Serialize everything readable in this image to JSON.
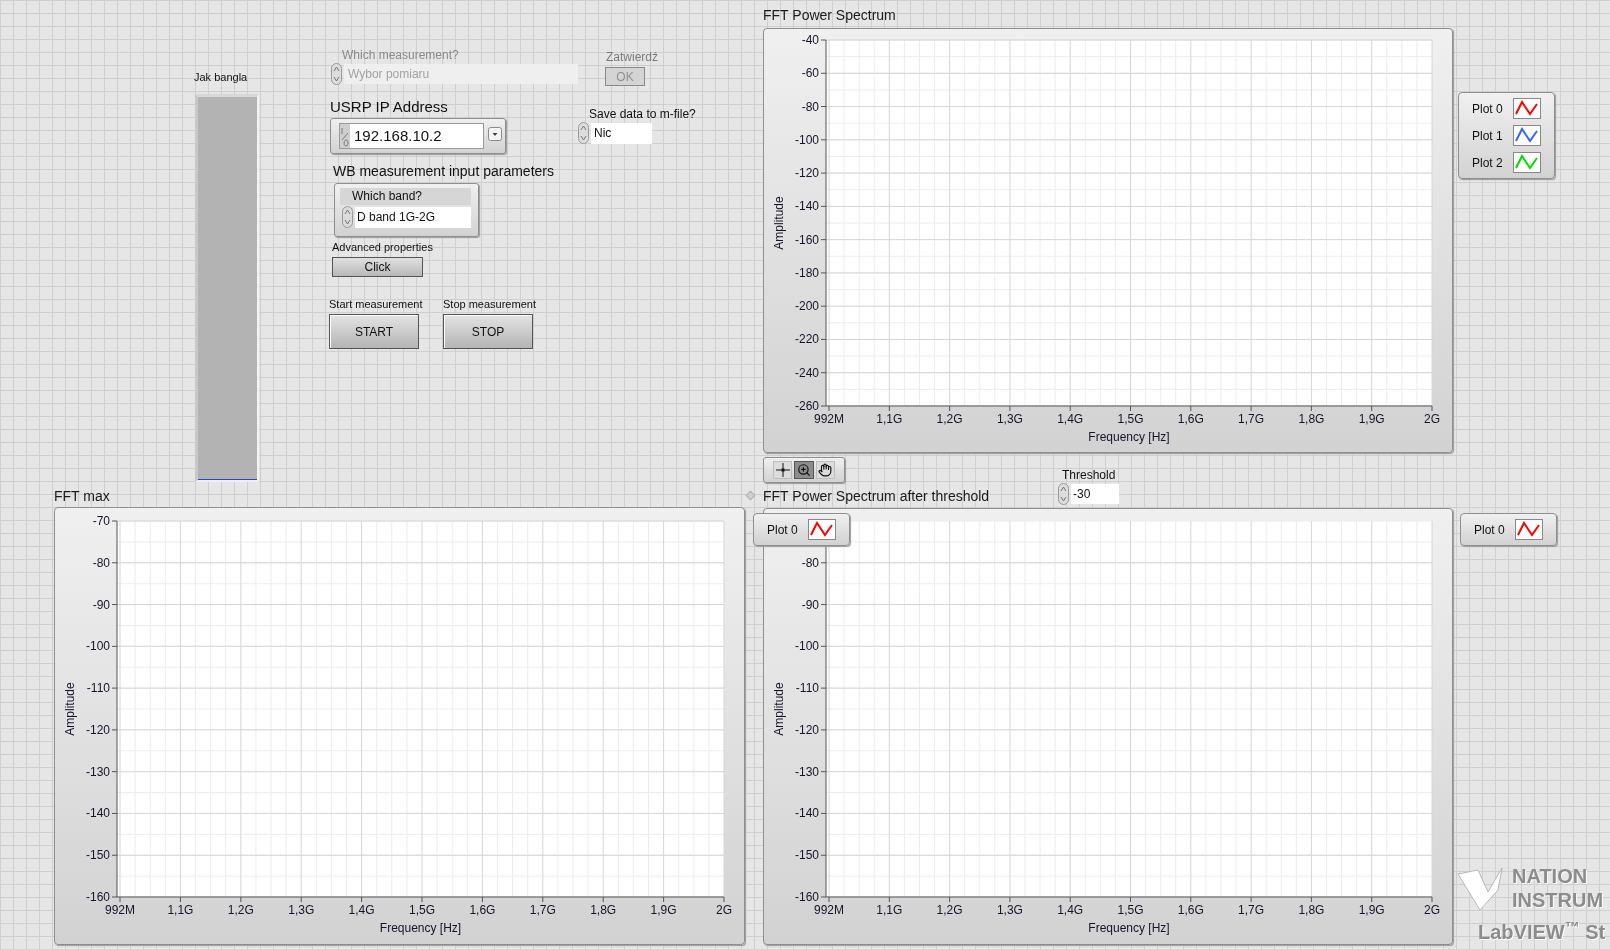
{
  "level_meter": {
    "label": "Jak bangla",
    "level": 0
  },
  "measurement_select": {
    "label": "Which measurement?",
    "value": "Wybor pomiaru",
    "disabled": true
  },
  "confirm": {
    "label": "Zatwierdź",
    "button": "OK",
    "disabled": true
  },
  "usrp_ip": {
    "label": "USRP IP Address",
    "value": "192.168.10.2"
  },
  "save_data": {
    "label": "Save data to m-file?",
    "value": "Nic"
  },
  "wb_params": {
    "title": "WB measurement input parameters",
    "band_label": "Which band?",
    "band_value": "D band 1G-2G"
  },
  "advanced": {
    "label": "Advanced properties",
    "button": "Click"
  },
  "start": {
    "label": "Start measurement",
    "button": "START"
  },
  "stop": {
    "label": "Stop measurement",
    "button": "STOP"
  },
  "graphs": [
    {
      "title": "FFT Power Spectrum",
      "legend": [
        {
          "name": "Plot 0",
          "color": "#ff0000"
        },
        {
          "name": "Plot 1",
          "color": "#3366ff"
        },
        {
          "name": "Plot 2",
          "color": "#00dd00"
        }
      ],
      "chart_data": {
        "type": "line",
        "grid": true,
        "xlabel": "Frequency [Hz]",
        "ylabel": "Amplitude",
        "ylim": [
          -260,
          -40
        ],
        "categories": [
          "992M",
          "1,1G",
          "1,2G",
          "1,3G",
          "1,4G",
          "1,5G",
          "1,6G",
          "1,7G",
          "1,8G",
          "1,9G",
          "2G"
        ],
        "yticks": [
          -40,
          -60,
          -80,
          -100,
          -120,
          -140,
          -160,
          -180,
          -200,
          -220,
          -240,
          -260
        ]
      }
    },
    {
      "title": "FFT max",
      "chart_data": {
        "type": "line",
        "grid": true,
        "xlabel": "Frequency [Hz]",
        "ylabel": "Amplitude",
        "ylim": [
          -160,
          -70
        ],
        "categories": [
          "992M",
          "1,1G",
          "1,2G",
          "1,3G",
          "1,4G",
          "1,5G",
          "1,6G",
          "1,7G",
          "1,8G",
          "1,9G",
          "2G"
        ],
        "yticks": [
          -70,
          -80,
          -90,
          -100,
          -110,
          -120,
          -130,
          -140,
          -150,
          -160
        ]
      }
    },
    {
      "title": "FFT Power Spectrum after threshold",
      "inner_legend": [
        {
          "name": "Plot 0",
          "color": "#ff0000"
        }
      ],
      "legend": [
        {
          "name": "Plot 0",
          "color": "#ff0000"
        }
      ],
      "chart_data": {
        "type": "line",
        "grid": true,
        "xlabel": "Frequency [Hz]",
        "ylabel": "Amplitude",
        "ylim": [
          -160,
          -70
        ],
        "categories": [
          "992M",
          "1,1G",
          "1,2G",
          "1,3G",
          "1,4G",
          "1,5G",
          "1,6G",
          "1,7G",
          "1,8G",
          "1,9G",
          "2G"
        ],
        "yticks": [
          -80,
          -90,
          -100,
          -110,
          -120,
          -130,
          -140,
          -150,
          -160
        ]
      }
    }
  ],
  "graph_tools": [
    {
      "kind": "cursor",
      "selected": false
    },
    {
      "kind": "zoom",
      "selected": true
    },
    {
      "kind": "pan",
      "selected": false
    }
  ],
  "threshold": {
    "label": "Threshold",
    "value": "-30"
  },
  "watermark": {
    "lines": [
      "NATION",
      "INSTRUM",
      "LabVIEW$^{™}$ St"
    ]
  }
}
